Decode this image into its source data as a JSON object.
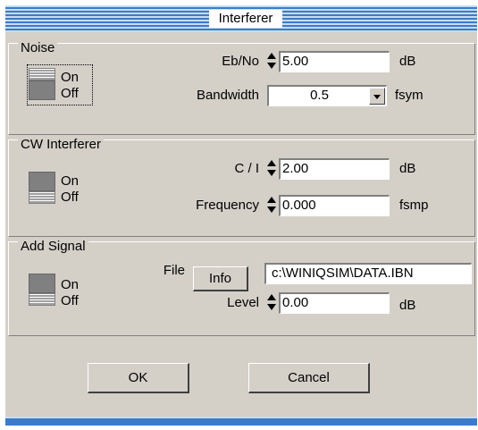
{
  "window": {
    "title": "Interferer"
  },
  "noise": {
    "legend": "Noise",
    "toggle_on": "On",
    "toggle_off": "Off",
    "ebno_label": "Eb/No",
    "ebno_value": "5.00",
    "ebno_unit": "dB",
    "bandwidth_label": "Bandwidth",
    "bandwidth_value": "0.5",
    "bandwidth_unit": "fsym"
  },
  "cw": {
    "legend": "CW Interferer",
    "toggle_on": "On",
    "toggle_off": "Off",
    "ci_label": "C / I",
    "ci_value": "2.00",
    "ci_unit": "dB",
    "freq_label": "Frequency",
    "freq_value": "0.000",
    "freq_unit": "fsmp"
  },
  "add_signal": {
    "legend": "Add Signal",
    "toggle_on": "On",
    "toggle_off": "Off",
    "file_label": "File",
    "info_button": "Info",
    "file_value": "c:\\WINIQSIM\\DATA.IBN",
    "level_label": "Level",
    "level_value": "0.00",
    "level_unit": "dB"
  },
  "buttons": {
    "ok_mnemonic": "O",
    "ok_rest": "K",
    "cancel_mnemonic": "C",
    "cancel_rest": "ancel"
  }
}
